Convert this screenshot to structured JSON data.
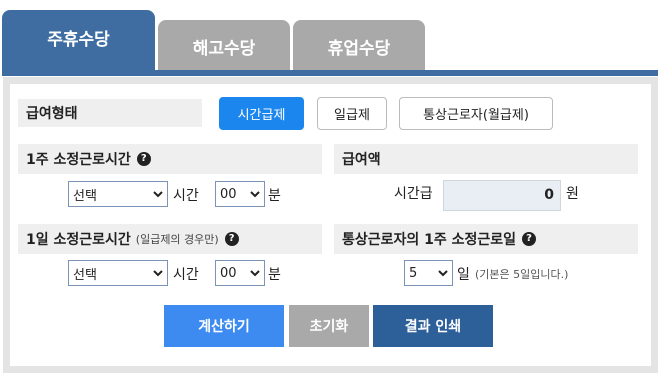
{
  "tabs": [
    {
      "label": "주휴수당"
    },
    {
      "label": "해고수당"
    },
    {
      "label": "휴업수당"
    }
  ],
  "pay_type": {
    "label": "급여형태",
    "options": [
      "시간급제",
      "일급제",
      "통상근로자(월급제)"
    ],
    "selected": "시간급제"
  },
  "weekly_hours": {
    "label": "1주 소정근로시간",
    "hour_value": "선택",
    "hour_unit": "시간",
    "minute_value": "00",
    "minute_unit": "분"
  },
  "wage": {
    "label": "급여액",
    "prefix": "시간급",
    "value": "0",
    "unit": "원"
  },
  "daily_hours": {
    "label": "1일 소정근로시간",
    "note": "(일급제의 경우만)",
    "hour_value": "선택",
    "hour_unit": "시간",
    "minute_value": "00",
    "minute_unit": "분"
  },
  "work_days": {
    "label": "통상근로자의 1주 소정근로일",
    "value": "5",
    "unit": "일",
    "note": "(기본은 5일입니다.)"
  },
  "buttons": {
    "calculate": "계산하기",
    "reset": "초기화",
    "print": "결과 인쇄"
  },
  "help_glyph": "?",
  "colors": {
    "tab_active": "#3f6da2",
    "tab_inactive": "#a9a9a9",
    "accent": "#1a86ee",
    "calc_button": "#3d8bf0",
    "print_button": "#2d5f99"
  }
}
